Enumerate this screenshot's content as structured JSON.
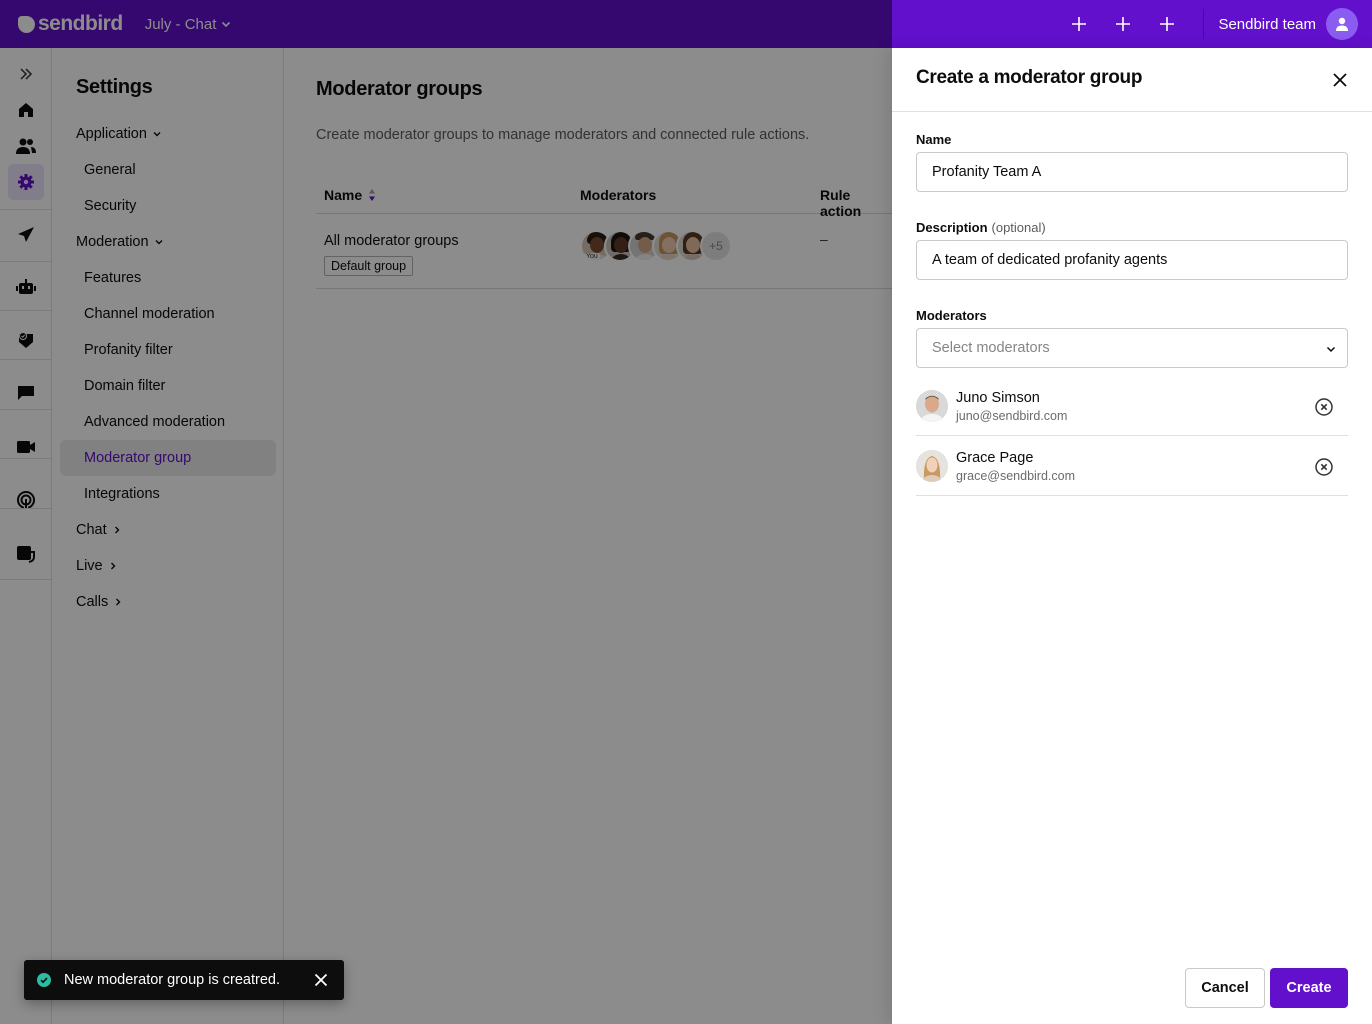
{
  "topbar": {
    "brand": "sendbird",
    "app_name": "July - Chat",
    "plus_buttons": [
      "add",
      "add",
      "add"
    ],
    "team_name": "Sendbird team",
    "brand_color": "#6210cc"
  },
  "rail": {
    "items": [
      {
        "icon": "expand-icon"
      },
      {
        "icon": "home-icon"
      },
      {
        "icon": "users-icon"
      },
      {
        "icon": "settings-icon",
        "active": true
      },
      {
        "icon": "send-icon"
      },
      {
        "icon": "bot-icon"
      },
      {
        "icon": "shield-check-icon"
      },
      {
        "icon": "chat-icon"
      },
      {
        "icon": "video-icon"
      },
      {
        "icon": "broadcast-icon"
      },
      {
        "icon": "desk-icon"
      }
    ]
  },
  "settings_nav": {
    "title": "Settings",
    "groups": [
      {
        "label": "Application",
        "expanded": true,
        "items": [
          "General",
          "Security"
        ]
      },
      {
        "label": "Moderation",
        "expanded": true,
        "items": [
          "Features",
          "Channel moderation",
          "Profanity filter",
          "Domain filter",
          "Advanced moderation",
          "Moderator group",
          "Integrations"
        ]
      },
      {
        "label": "Chat",
        "expanded": false
      },
      {
        "label": "Live",
        "expanded": false
      },
      {
        "label": "Calls",
        "expanded": false
      }
    ],
    "active_item": "Moderator group"
  },
  "main": {
    "title": "Moderator groups",
    "description": "Create moderator groups to manage moderators and connected rule actions.",
    "table": {
      "columns": [
        "Name",
        "Moderators",
        "Rule action"
      ],
      "sort_column": "Name",
      "rows": [
        {
          "name": "All moderator groups",
          "badge": "Default group",
          "moderators_shown": 5,
          "you_label": "You",
          "more_count": "+5",
          "rule_action": "–"
        }
      ]
    }
  },
  "drawer": {
    "title": "Create a moderator group",
    "name_label": "Name",
    "name_value": "Profanity Team A",
    "description_label": "Description",
    "description_optional": "(optional)",
    "description_value": "A team of dedicated profanity agents",
    "moderators_label": "Moderators",
    "moderators_placeholder": "Select moderators",
    "moderators": [
      {
        "name": "Juno Simson",
        "email": "juno@sendbird.com"
      },
      {
        "name": "Grace Page",
        "email": "grace@sendbird.com"
      }
    ],
    "cancel_label": "Cancel",
    "create_label": "Create"
  },
  "toast": {
    "message": "New moderator group is creatred.",
    "status": "success",
    "status_color": "#2eba9f"
  }
}
